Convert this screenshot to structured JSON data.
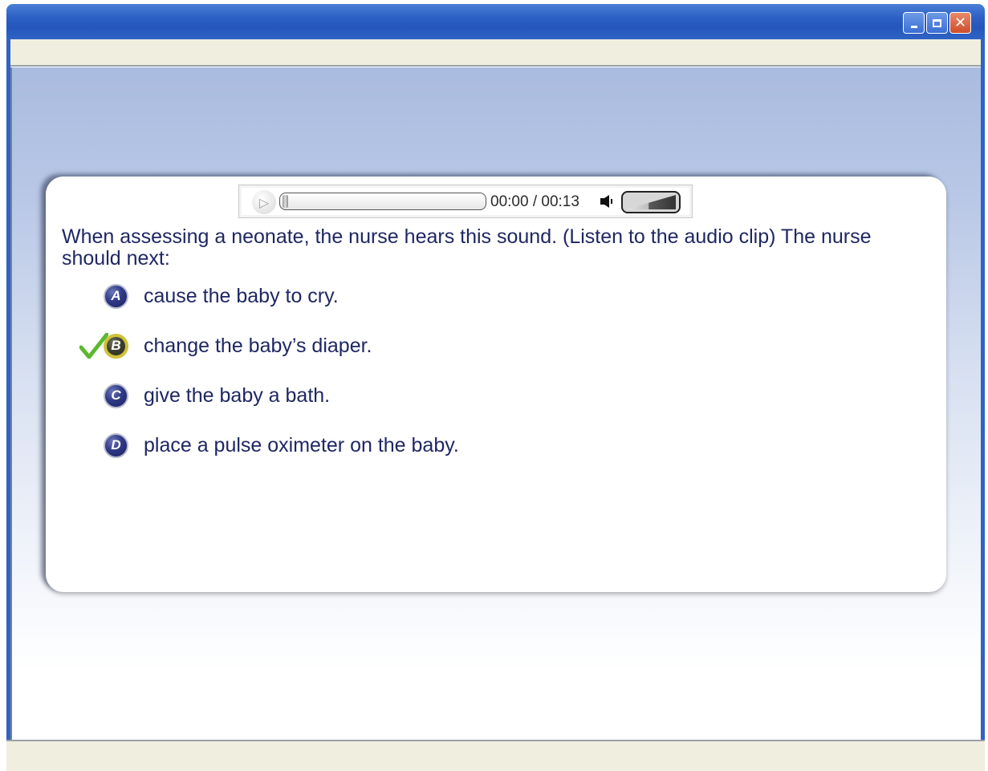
{
  "window": {
    "controls": {
      "minimize_icon": "minimize-icon",
      "maximize_icon": "maximize-icon",
      "close_icon": "close-icon"
    }
  },
  "player": {
    "time_display": "00:00 / 00:13",
    "progress_fraction": 0,
    "icons": {
      "play": "play-icon",
      "speaker": "speaker-icon",
      "volume": "volume-slider"
    }
  },
  "question": {
    "text": "When assessing a neonate, the nurse hears this sound. (Listen to the audio clip) The nurse should next:"
  },
  "options": [
    {
      "letter": "A",
      "text": "cause the baby to cry.",
      "selected": false
    },
    {
      "letter": "B",
      "text": "change the baby’s diaper.",
      "selected": true
    },
    {
      "letter": "C",
      "text": "give the baby a bath.",
      "selected": false
    },
    {
      "letter": "D",
      "text": "place a pulse oximeter on the baby.",
      "selected": false
    }
  ],
  "colors": {
    "titlebar": "#2f63c4",
    "text": "#1e2763",
    "badge": "#2f3a86",
    "selected_ring": "#cfc23a",
    "checkmark": "#5cb82e"
  }
}
